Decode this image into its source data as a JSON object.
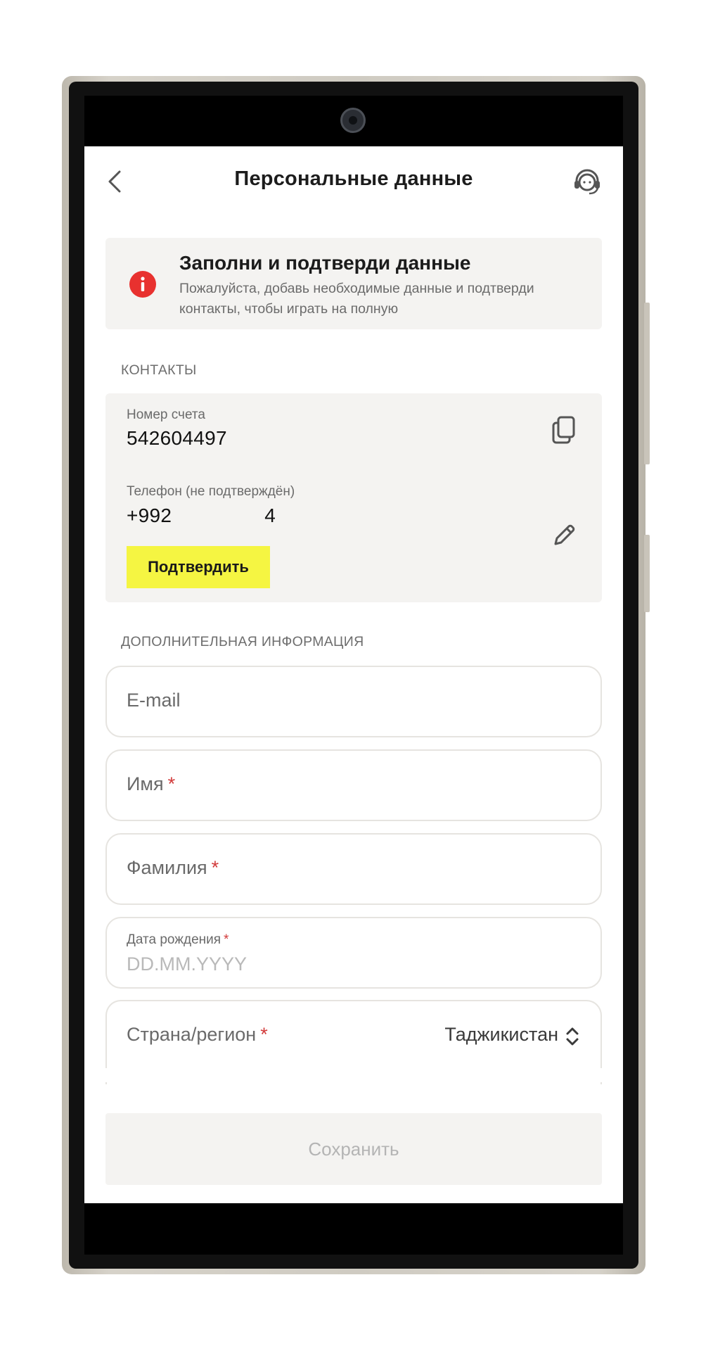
{
  "header": {
    "title": "Персональные данные"
  },
  "alert": {
    "title": "Заполни и подтверди данные",
    "text": "Пожалуйста, добавь необходимые данные и подтверди контакты, чтобы играть на полную"
  },
  "contacts": {
    "section_label": "КОНТАКТЫ",
    "account": {
      "label": "Номер счета",
      "value": "542604497"
    },
    "phone": {
      "label": "Телефон (не подтверждён)",
      "value_start": "+992",
      "value_end": "4"
    },
    "confirm_label": "Подтвердить"
  },
  "additional": {
    "section_label": "ДОПОЛНИТЕЛЬНАЯ ИНФОРМАЦИЯ",
    "email": {
      "placeholder": "E-mail"
    },
    "first_name": {
      "placeholder": "Имя",
      "required": "*"
    },
    "last_name": {
      "placeholder": "Фамилия",
      "required": "*"
    },
    "birth_date": {
      "label": "Дата рождения",
      "required": "*",
      "placeholder": "DD.MM.YYYY"
    },
    "country": {
      "label": "Страна/регион",
      "required": "*",
      "value": "Таджикистан"
    }
  },
  "save_label": "Сохранить",
  "colors": {
    "accent_yellow": "#f5f542",
    "alert_red": "#e8312f",
    "card_bg": "#f4f3f1"
  },
  "icons": [
    "back-arrow-icon",
    "support-headset-icon",
    "info-icon",
    "copy-icon",
    "pencil-icon",
    "up-down-chevron-icon",
    "camera-icon"
  ]
}
